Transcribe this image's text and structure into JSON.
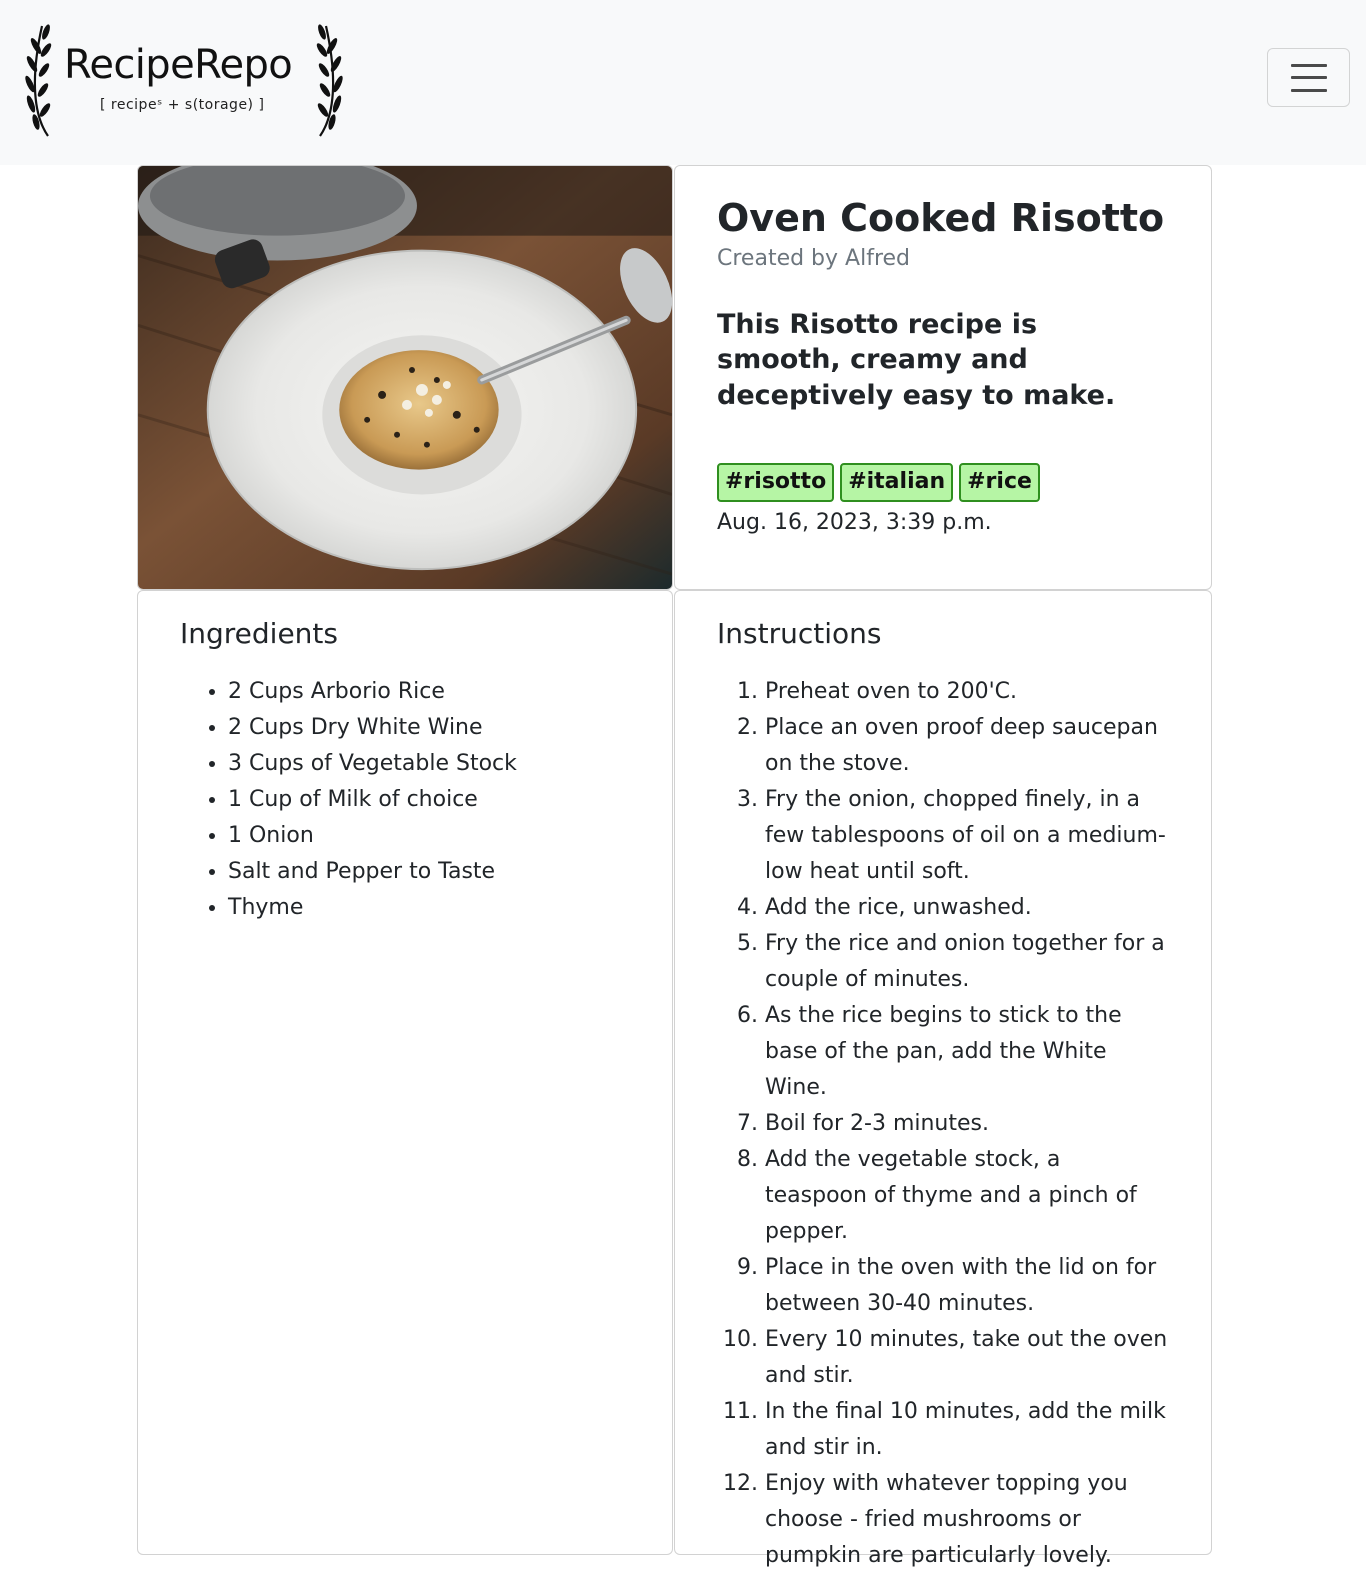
{
  "navbar": {
    "brand_name": "RecipeRepo",
    "brand_tagline": "[ recipeˢ + s(torage) ]",
    "toggler_icon": "hamburger-menu-icon"
  },
  "recipe": {
    "image_alt": "Bowl of risotto on a wooden table",
    "title": "Oven Cooked Risotto",
    "author": "Created by Alfred",
    "description": "This Risotto recipe is smooth, creamy and deceptively easy to make.",
    "tags": [
      "#risotto",
      "#italian",
      "#rice"
    ],
    "date": "Aug. 16, 2023, 3:39 p.m.",
    "tag_color": "#b6f5a5",
    "tag_border_color": "#2f8f1f"
  },
  "ingredients": {
    "heading": "Ingredients",
    "items": [
      "2 Cups Arborio Rice",
      "2 Cups Dry White Wine",
      "3 Cups of Vegetable Stock",
      "1 Cup of Milk of choice",
      "1 Onion",
      "Salt and Pepper to Taste",
      "Thyme"
    ]
  },
  "instructions": {
    "heading": "Instructions",
    "steps": [
      "Preheat oven to 200'C.",
      "Place an oven proof deep saucepan on the stove.",
      "Fry the onion, chopped finely, in a few tablespoons of oil on a medium-low heat until soft.",
      "Add the rice, unwashed.",
      "Fry the rice and onion together for a couple of minutes.",
      "As the rice begins to stick to the base of the pan, add the White Wine.",
      "Boil for 2-3 minutes.",
      "Add the vegetable stock, a teaspoon of thyme and a pinch of pepper.",
      "Place in the oven with the lid on for between 30-40 minutes.",
      "Every 10 minutes, take out the oven and stir.",
      "In the final 10 minutes, add the milk and stir in.",
      "Enjoy with whatever topping you choose - fried mushrooms or pumpkin are particularly lovely."
    ]
  }
}
